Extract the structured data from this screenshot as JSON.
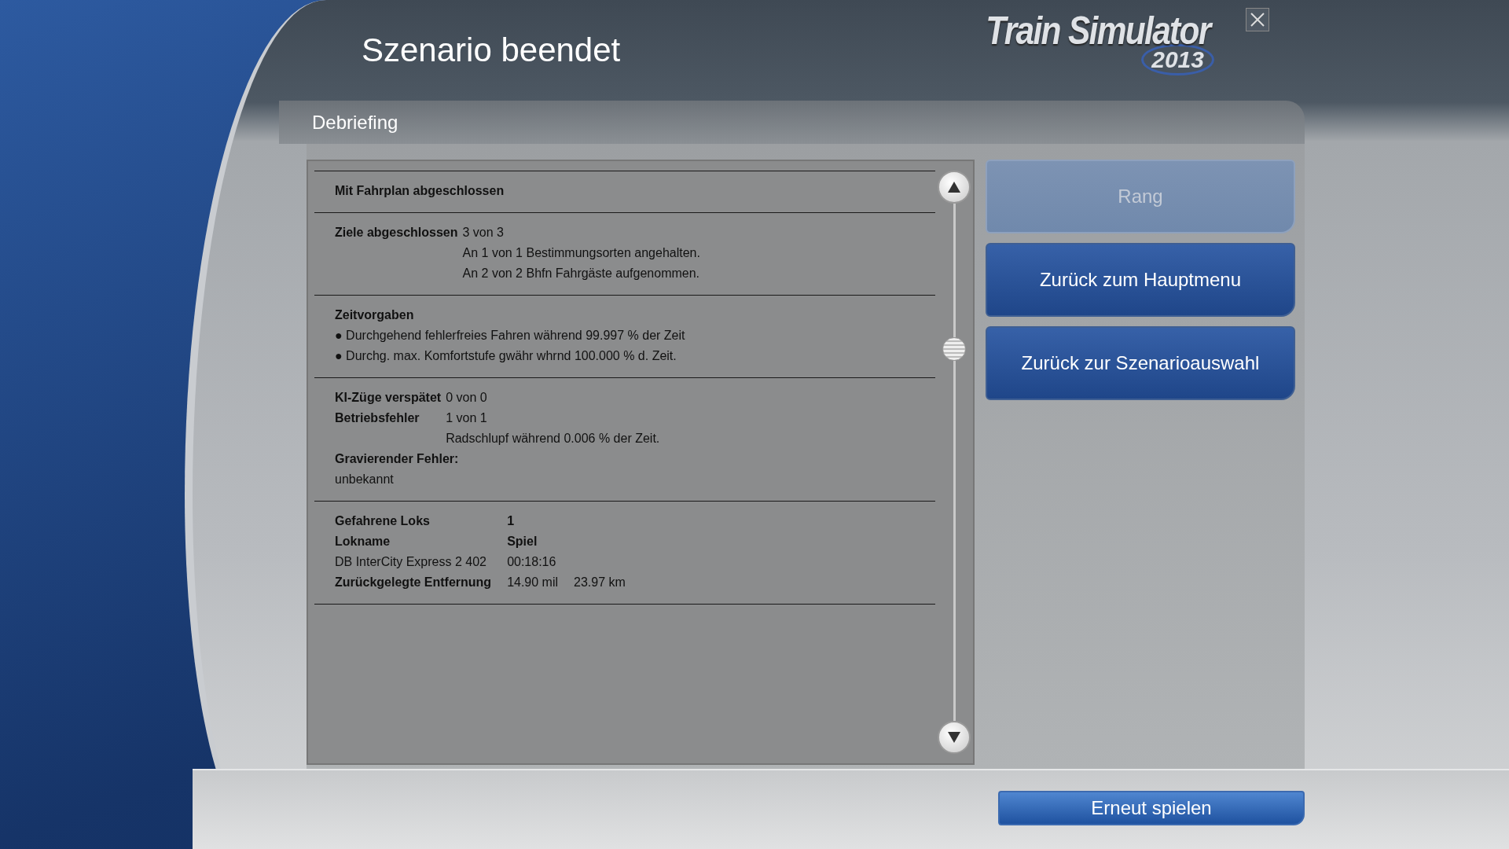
{
  "window": {
    "title": "Szenario beendet"
  },
  "logo": {
    "name": "Train Simulator",
    "year": "2013"
  },
  "panel": {
    "title": "Debriefing"
  },
  "sections": [
    {
      "kind": "summary",
      "rows": [
        {
          "kind": "cells",
          "cells": [
            {
              "text": "Mit Fahrplan abgeschlossen",
              "bold": true
            }
          ]
        }
      ]
    },
    {
      "kind": "summary",
      "rows": [
        {
          "kind": "cells",
          "cells": [
            {
              "text": "Ziele abgeschlossen",
              "bold": true
            },
            {
              "text": "3 von 3",
              "bold": false
            }
          ]
        },
        {
          "kind": "cells",
          "cells": [
            {
              "text": ""
            },
            {
              "text": "An 1 von 1 Bestimmungsorten angehalten.",
              "bold": false
            }
          ]
        },
        {
          "kind": "cells",
          "cells": [
            {
              "text": ""
            },
            {
              "text": "An 2 von 2 Bhfn Fahrgäste aufgenommen.",
              "bold": false
            }
          ]
        }
      ]
    },
    {
      "kind": "summary",
      "rows": [
        {
          "kind": "full",
          "cells": [
            {
              "text": "Zeitvorgaben",
              "bold": true
            }
          ]
        },
        {
          "kind": "full",
          "cells": [
            {
              "text": "● Durchgehend fehlerfreies Fahren während 99.997 % der Zeit",
              "bold": false
            }
          ]
        },
        {
          "kind": "full",
          "cells": [
            {
              "text": "● Durchg. max. Komfortstufe gwähr whrnd 100.000 % d. Zeit.",
              "bold": false
            }
          ]
        }
      ]
    },
    {
      "kind": "summary",
      "rows": [
        {
          "kind": "cells",
          "cells": [
            {
              "text": "KI-Züge verspätet",
              "bold": true
            },
            {
              "text": "0 von 0",
              "bold": false
            }
          ]
        },
        {
          "kind": "cells",
          "cells": [
            {
              "text": "Betriebsfehler",
              "bold": true
            },
            {
              "text": "1 von 1",
              "bold": false
            }
          ]
        },
        {
          "kind": "cells",
          "cells": [
            {
              "text": ""
            },
            {
              "text": "Radschlupf während 0.006 % der Zeit.",
              "bold": false
            }
          ]
        },
        {
          "kind": "full",
          "cells": [
            {
              "text": "Gravierender Fehler:",
              "bold": true
            }
          ]
        },
        {
          "kind": "full",
          "cells": [
            {
              "text": "unbekannt",
              "bold": false
            }
          ]
        }
      ]
    },
    {
      "kind": "table",
      "rows": [
        {
          "kind": "cells",
          "cells": [
            {
              "text": "Gefahrene Loks",
              "bold": true
            },
            {
              "text": "1",
              "bold": true
            }
          ]
        },
        {
          "kind": "cells",
          "cells": [
            {
              "text": "Lokname",
              "bold": true
            },
            {
              "text": "Spiel",
              "bold": true
            }
          ]
        },
        {
          "kind": "cells",
          "cells": [
            {
              "text": "DB InterCity Express 2 402",
              "bold": false
            },
            {
              "text": "00:18:16",
              "bold": false
            }
          ]
        },
        {
          "kind": "cells",
          "cells": [
            {
              "text": "Zurückgelegte Entfernung",
              "bold": true
            },
            {
              "text": "14.90 mil",
              "bold": false
            },
            {
              "text": "23.97 km",
              "bold": false
            }
          ]
        }
      ]
    }
  ],
  "menu_buttons": [
    {
      "label": "Rang",
      "disabled": true
    },
    {
      "label": "Zurück zum Hauptmenu",
      "disabled": false
    },
    {
      "label": "Zurück zur Szenarioauswahl",
      "disabled": false
    }
  ],
  "footer_button": {
    "label": "Erneut spielen"
  }
}
